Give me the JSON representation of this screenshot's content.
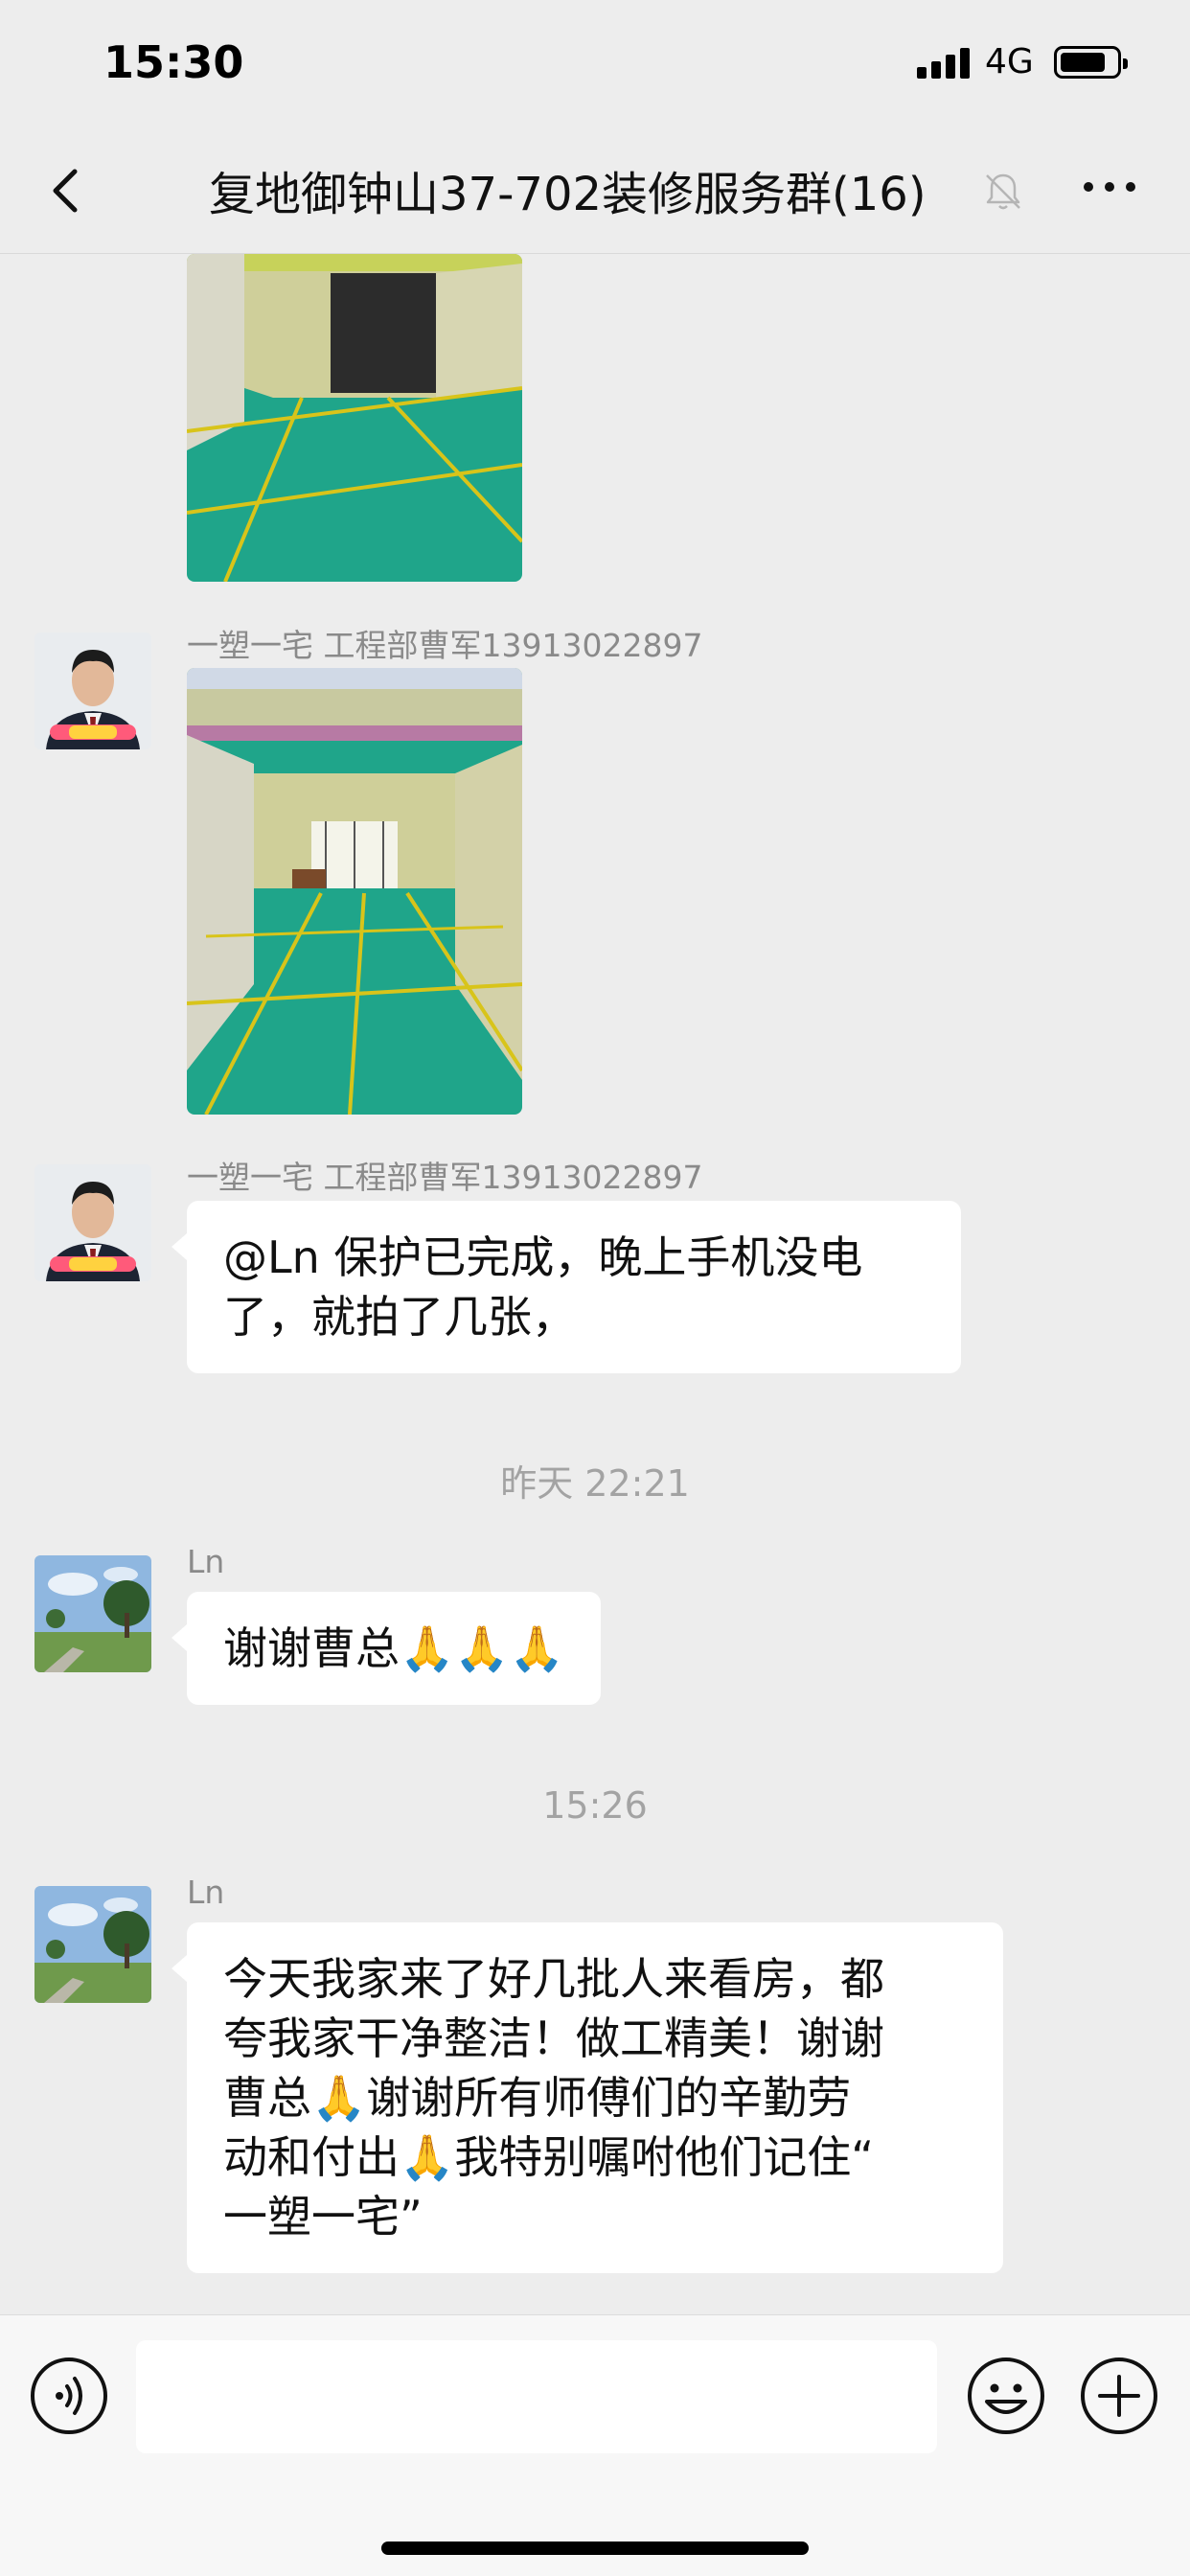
{
  "status_bar": {
    "time": "15:30",
    "network": "4G"
  },
  "header": {
    "title": "复地御钟山37-702装修服务群(16)"
  },
  "messages": [
    {
      "sender": "一塑一宅 工程部曹军13913022897"
    },
    {
      "sender": "一塑一宅 工程部曹军13913022897",
      "text": "@Ln 保护已完成，晚上手机没电\n了，就拍了几张，"
    },
    {
      "timestamp": "昨天 22:21"
    },
    {
      "sender": "Ln",
      "text": "谢谢曹总🙏🙏🙏"
    },
    {
      "timestamp": "15:26"
    },
    {
      "sender": "Ln",
      "text": "今天我家来了好几批人来看房，都\n夸我家干净整洁！做工精美！谢谢\n曹总🙏谢谢所有师傅们的辛勤劳\n动和付出🙏我特别嘱咐他们记住“\n一塑一宅”"
    }
  ],
  "colors": {
    "background": "#ededed",
    "bubble": "#ffffff",
    "floor_green": "#1fa58a",
    "tape_yellow": "#d8c41a"
  },
  "icons": [
    "back-icon",
    "mute-bell-icon",
    "more-icon",
    "voice-icon",
    "emoji-icon",
    "plus-icon"
  ]
}
